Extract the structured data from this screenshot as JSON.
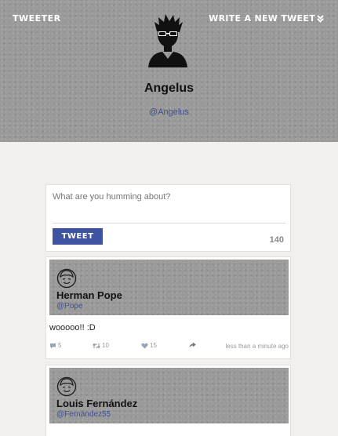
{
  "nav": {
    "brand": "TWEETER",
    "write_label": "WRITE A NEW TWEET",
    "write_icon": "double-chevron-down-icon"
  },
  "profile": {
    "name": "Angelus",
    "handle": "@Angelus",
    "avatar_icon": "sunglasses-person-icon"
  },
  "compose": {
    "placeholder": "What are you humming about?",
    "button_label": "TWEET",
    "char_count": "140"
  },
  "tweets": [
    {
      "name": "Herman Pope",
      "handle": "@Pope",
      "text": "wooooo!! :D",
      "replies": "5",
      "retweets": "10",
      "likes": "15",
      "time": "less than a minute ago"
    },
    {
      "name": "Louis Fernández",
      "handle": "@Fernández55"
    }
  ],
  "colors": {
    "accent": "#3e54a0",
    "header_bg": "#9a9a9a",
    "page_bg": "#f2f0ec"
  }
}
